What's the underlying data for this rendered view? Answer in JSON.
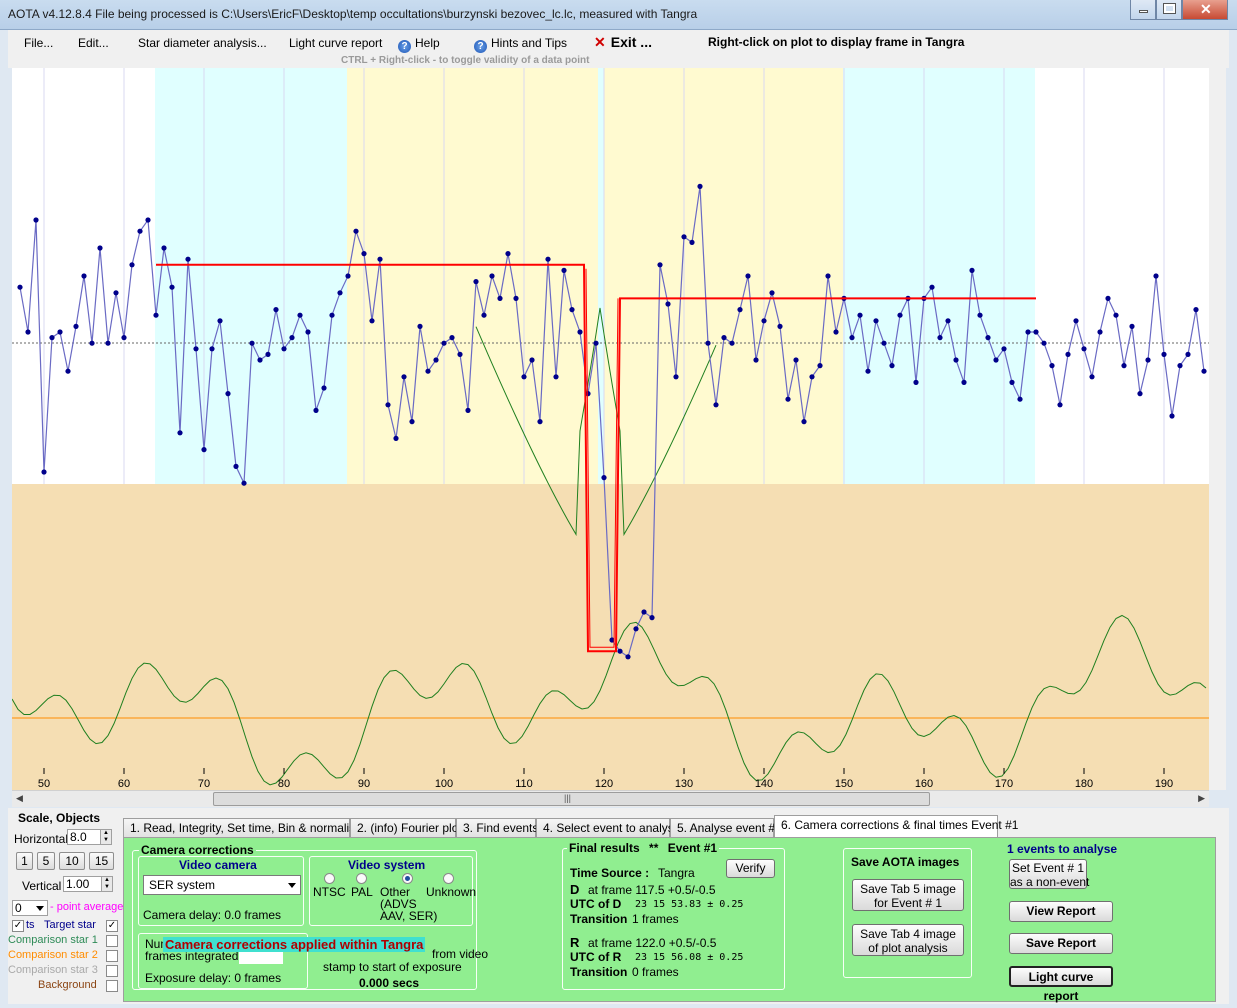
{
  "window": {
    "title": "AOTA v4.12.8.4    File being processed is C:\\Users\\EricF\\Desktop\\temp occultations\\burzynski bezovec_lc.lc, measured with Tangra"
  },
  "menu": {
    "file": "File...",
    "edit": "Edit...",
    "star_diameter": "Star diameter analysis...",
    "light_curve_report": "Light curve report",
    "help": "Help",
    "hints": "Hints and Tips",
    "exit": "Exit ...",
    "right_click_hint": "Right-click on plot to display frame in Tangra",
    "ctrl_hint": "CTRL + Right-click  -  to toggle validity of a data point"
  },
  "plot": {
    "x_ticks": [
      "50",
      "60",
      "70",
      "80",
      "90",
      "100",
      "110",
      "120",
      "130",
      "140",
      "150",
      "160",
      "170",
      "180",
      "190"
    ],
    "colors": {
      "baseline_region": "#e0ffff",
      "search_region": "#fffad0",
      "lower_panel": "#f5deb3",
      "target_line": "#6a6ac4",
      "model_line": "#ff0000",
      "green_line": "#1f7f1f",
      "orange_line": "#ff8c00"
    }
  },
  "chart_data": {
    "type": "line",
    "x_start": 47,
    "x_step": 1,
    "y_unit": "screen-brightness (upper panel, arbitrary)",
    "series": [
      {
        "name": "Target star",
        "values": [
          0.68,
          0.6,
          0.8,
          0.35,
          0.59,
          0.6,
          0.53,
          0.61,
          0.7,
          0.58,
          0.75,
          0.58,
          0.67,
          0.59,
          0.72,
          0.78,
          0.8,
          0.63,
          0.75,
          0.68,
          0.42,
          0.73,
          0.57,
          0.39,
          0.57,
          0.62,
          0.49,
          0.36,
          0.33,
          0.58,
          0.55,
          0.56,
          0.64,
          0.57,
          0.59,
          0.63,
          0.6,
          0.46,
          0.5,
          0.63,
          0.67,
          0.7,
          0.78,
          0.74,
          0.62,
          0.73,
          0.47,
          0.41,
          0.52,
          0.44,
          0.61,
          0.53,
          0.55,
          0.58,
          0.59,
          0.56,
          0.46,
          0.69,
          0.63,
          0.7,
          0.66,
          0.74,
          0.66,
          0.52,
          0.55,
          0.44,
          0.73,
          0.52,
          0.71,
          0.64,
          0.6,
          0.49,
          0.58,
          0.34,
          0.05,
          0.03,
          0.02,
          0.07,
          0.1,
          0.09,
          0.72,
          0.65,
          0.52,
          0.77,
          0.76,
          0.86,
          0.58,
          0.47,
          0.59,
          0.58,
          0.64,
          0.7,
          0.55,
          0.62,
          0.67,
          0.61,
          0.48,
          0.55,
          0.44,
          0.52,
          0.54,
          0.7,
          0.6,
          0.66,
          0.59,
          0.63,
          0.53,
          0.62,
          0.58,
          0.54,
          0.63,
          0.66,
          0.51,
          0.66,
          0.68,
          0.59,
          0.62,
          0.55,
          0.51,
          0.71,
          0.63,
          0.59,
          0.55,
          0.57,
          0.51,
          0.48,
          0.6,
          0.6,
          0.58,
          0.54,
          0.47,
          0.56,
          0.62,
          0.57,
          0.52,
          0.6,
          0.66,
          0.63,
          0.54,
          0.61,
          0.49,
          0.55,
          0.7,
          0.56,
          0.45,
          0.54,
          0.56,
          0.64,
          0.53,
          0.49,
          0.58,
          0.61,
          0.57,
          0.52,
          0.6,
          0.66,
          0.63,
          0.5,
          0.53,
          0.62,
          0.48,
          0.54,
          0.57,
          0.63,
          0.55,
          0.53,
          0.61,
          0.58,
          0.52,
          0.49,
          0.6,
          0.64,
          0.58,
          0.55
        ]
      }
    ],
    "model": {
      "baseline": 0.72,
      "bottom": 0.03,
      "D_frame": 117.5,
      "R_frame": 122.0,
      "post_level": 0.66
    },
    "ylim": [
      0,
      1
    ]
  },
  "left": {
    "title": "Scale,  Objects",
    "horizontal_label": "Horizontal",
    "horizontal_value": "8.0",
    "scale_buttons": [
      "1",
      "5",
      "10",
      "15"
    ],
    "vertical_label": "Vertical",
    "vertical_value": "1.00",
    "point_avg_value": "0",
    "point_avg_label": "- point average",
    "pts_label": "ts",
    "target_star": "Target star",
    "comp1": "Comparison star 1",
    "comp2": "Comparison star 2",
    "comp3": "Comparison star 3",
    "background": "Background",
    "colors": {
      "comp1": "#2e8b57",
      "comp2": "#ff8c00",
      "comp3": "#a9a9a9",
      "background": "#8b4513",
      "target": "#00008b",
      "pointavg": "#ff00ff"
    }
  },
  "tabs": [
    "1.  Read, Integrity, Set time, Bin & normalise",
    "2. (info)  Fourier plot",
    "3. Find events",
    "4. Select event to analyse",
    "5. Analyse event #1",
    "6. Camera corrections & final times Event #1"
  ],
  "camera": {
    "group_title": "Camera corrections",
    "video_camera_title": "Video camera",
    "camera_select": "SER system",
    "camera_delay": "Camera delay: 0.0 frames",
    "video_system_title": "Video system",
    "radios": [
      "NTSC",
      "PAL",
      "Other",
      "Unknown"
    ],
    "other_note": "(ADVS\nAAV, SER)",
    "num_frames_prefix": "Num",
    "frames_integrated": "frames integrated",
    "applied_banner": "Camera corrections applied within Tangra",
    "exposure_delay": "Exposure delay: 0 frames",
    "from_video": "from video",
    "stamp": "stamp to start of exposure",
    "secs": "0.000 secs"
  },
  "final": {
    "title": "Final results",
    "stars": "**",
    "event": "Event #1",
    "verify": "Verify",
    "time_source_label": "Time Source :",
    "time_source": "Tangra",
    "D": "D",
    "d_frame": "at frame 117.5  +0.5/-0.5",
    "utc_d_label": "UTC of D",
    "utc_d": "23 15 53.83  ± 0.25",
    "transition_label": "Transition",
    "d_transition": "1 frames",
    "R": "R",
    "r_frame": "at frame 122.0  +0.5/-0.5",
    "utc_r_label": "UTC of R",
    "utc_r": "23 15 56.08  ± 0.25",
    "r_transition": "0 frames"
  },
  "save": {
    "title": "Save AOTA images",
    "tab5": "Save Tab 5 image\nfor Event # 1",
    "tab4": "Save Tab 4 image\nof plot analysis"
  },
  "right": {
    "events_title": "1  events to analyse",
    "set_event": "Set Event # 1\nas a non-event",
    "view_report": "View Report",
    "save_report": "Save Report",
    "light_curve_report": "Light curve report"
  }
}
